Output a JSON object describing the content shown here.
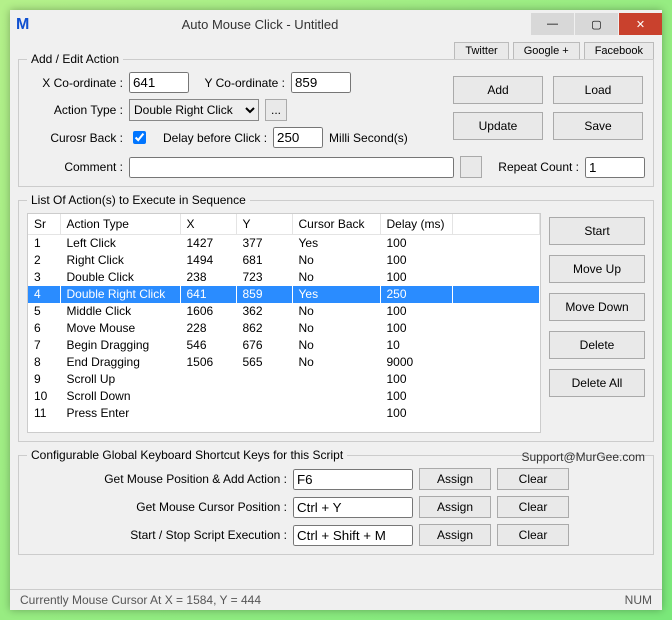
{
  "window": {
    "title": "Auto Mouse Click - Untitled"
  },
  "social": {
    "twitter": "Twitter",
    "google": "Google +",
    "facebook": "Facebook"
  },
  "win": {
    "min": "—",
    "max": "▢",
    "close": "✕"
  },
  "addedit": {
    "legend": "Add / Edit Action",
    "xlabel": "X Co-ordinate :",
    "xval": "641",
    "ylabel": "Y Co-ordinate :",
    "yval": "859",
    "action_label": "Action Type :",
    "action_selected": "Double Right Click",
    "more_btn": "...",
    "cursor_label": "Curosr Back :",
    "delay_label": "Delay before Click :",
    "delay_val": "250",
    "delay_units": "Milli Second(s)",
    "comment_label": "Comment :",
    "comment_val": "",
    "repeat_label": "Repeat Count :",
    "repeat_val": "1",
    "add": "Add",
    "load": "Load",
    "update": "Update",
    "save": "Save"
  },
  "list": {
    "legend": "List Of Action(s) to Execute in Sequence",
    "headers": {
      "sr": "Sr",
      "type": "Action Type",
      "x": "X",
      "y": "Y",
      "cb": "Cursor Back",
      "delay": "Delay (ms)"
    },
    "rows": [
      {
        "sr": "1",
        "type": "Left Click",
        "x": "1427",
        "y": "377",
        "cb": "Yes",
        "delay": "100",
        "sel": false
      },
      {
        "sr": "2",
        "type": "Right Click",
        "x": "1494",
        "y": "681",
        "cb": "No",
        "delay": "100",
        "sel": false
      },
      {
        "sr": "3",
        "type": "Double Click",
        "x": "238",
        "y": "723",
        "cb": "No",
        "delay": "100",
        "sel": false
      },
      {
        "sr": "4",
        "type": "Double Right Click",
        "x": "641",
        "y": "859",
        "cb": "Yes",
        "delay": "250",
        "sel": true
      },
      {
        "sr": "5",
        "type": "Middle Click",
        "x": "1606",
        "y": "362",
        "cb": "No",
        "delay": "100",
        "sel": false
      },
      {
        "sr": "6",
        "type": "Move Mouse",
        "x": "228",
        "y": "862",
        "cb": "No",
        "delay": "100",
        "sel": false
      },
      {
        "sr": "7",
        "type": "Begin Dragging",
        "x": "546",
        "y": "676",
        "cb": "No",
        "delay": "10",
        "sel": false
      },
      {
        "sr": "8",
        "type": "End Dragging",
        "x": "1506",
        "y": "565",
        "cb": "No",
        "delay": "9000",
        "sel": false
      },
      {
        "sr": "9",
        "type": "Scroll Up",
        "x": "",
        "y": "",
        "cb": "",
        "delay": "100",
        "sel": false
      },
      {
        "sr": "10",
        "type": "Scroll Down",
        "x": "",
        "y": "",
        "cb": "",
        "delay": "100",
        "sel": false
      },
      {
        "sr": "11",
        "type": "Press Enter",
        "x": "",
        "y": "",
        "cb": "",
        "delay": "100",
        "sel": false
      }
    ],
    "buttons": {
      "start": "Start",
      "moveup": "Move Up",
      "movedown": "Move Down",
      "delete": "Delete",
      "deleteall": "Delete All"
    }
  },
  "shortcuts": {
    "legend": "Configurable Global Keyboard Shortcut Keys for this Script",
    "support": "Support@MurGee.com",
    "assign": "Assign",
    "clear": "Clear",
    "row1": {
      "label": "Get Mouse Position & Add Action :",
      "val": "F6"
    },
    "row2": {
      "label": "Get Mouse Cursor Position :",
      "val": "Ctrl + Y"
    },
    "row3": {
      "label": "Start / Stop Script Execution :",
      "val": "Ctrl + Shift + M"
    }
  },
  "status": {
    "text": "Currently Mouse Cursor At X = 1584, Y = 444",
    "num": "NUM"
  }
}
